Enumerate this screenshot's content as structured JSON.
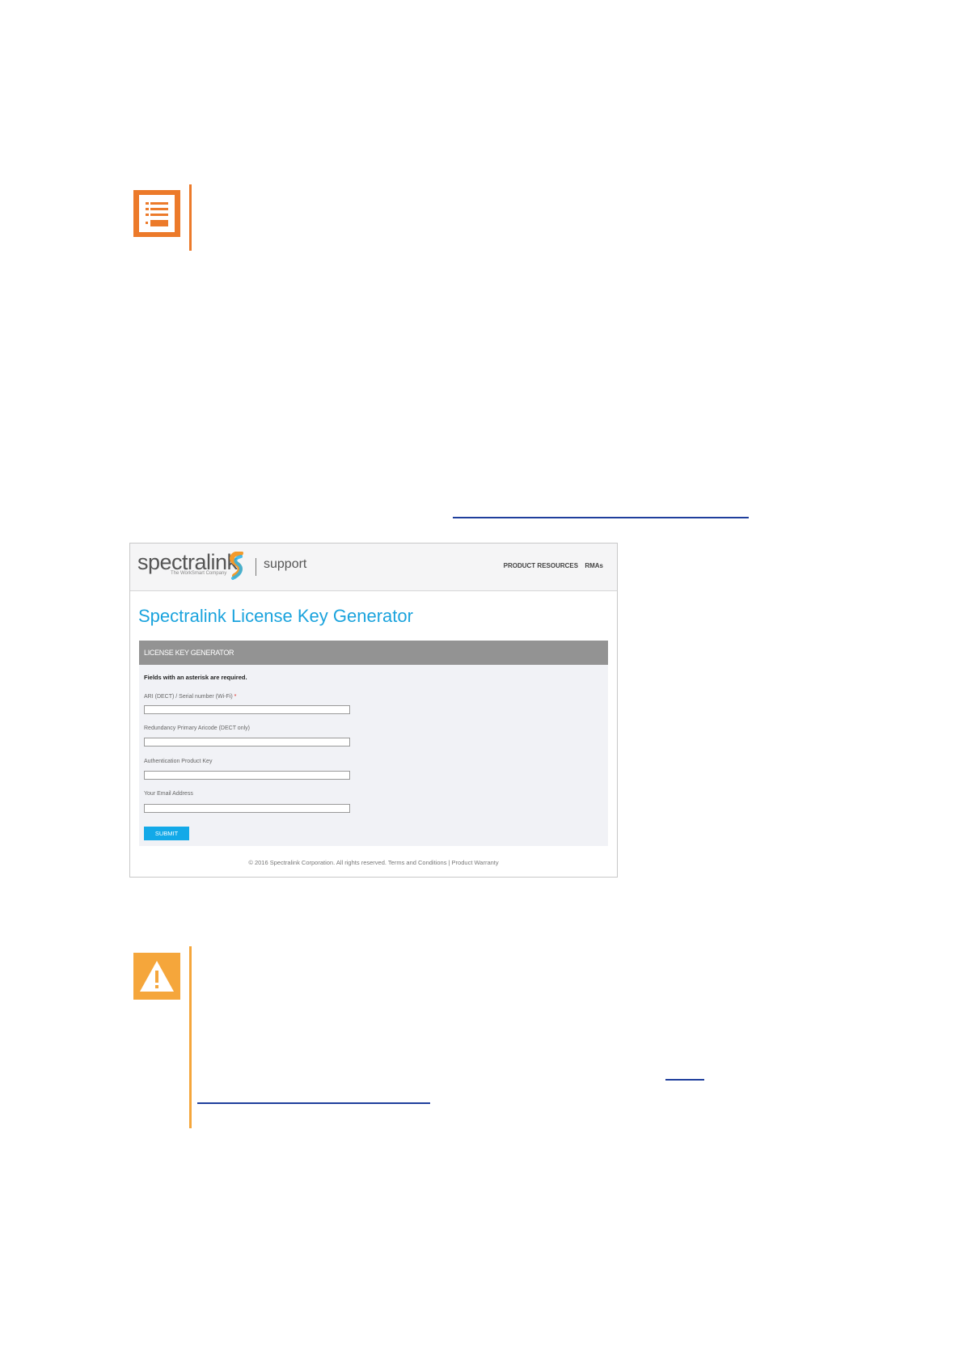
{
  "screenshot": {
    "brand": {
      "name": "spectralink",
      "tagline": "The WorkSmart Company",
      "section": "support"
    },
    "nav": {
      "product_resources": "PRODUCT RESOURCES",
      "rmas": "RMAs"
    },
    "title": "Spectralink License Key Generator",
    "panel": {
      "heading": "LICENSE KEY GENERATOR",
      "required_note": "Fields with an asterisk are required.",
      "fields": [
        {
          "label": "ARI (DECT) / Serial number (Wi-Fi)",
          "required": "*",
          "value": ""
        },
        {
          "label": "Redundancy Primary Aricode (DECT only)",
          "value": ""
        },
        {
          "label": "Authentication Product Key",
          "value": ""
        },
        {
          "label": "Your Email Address",
          "value": ""
        }
      ],
      "submit_label": "SUBMIT"
    },
    "footer": "© 2016 Spectralink Corporation. All rights reserved.   Terms and Conditions | Product Warranty"
  },
  "colors": {
    "note_accent": "#ec7a2a",
    "warning_accent": "#f5a63b",
    "link": "#1f3f9c",
    "title_blue": "#1aa3dd",
    "submit_blue": "#13a9e8"
  },
  "icons": {
    "note": "note-list-icon",
    "warning": "warning-triangle-icon"
  }
}
